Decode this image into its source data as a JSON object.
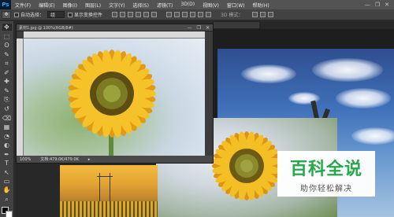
{
  "app": {
    "logo": "Ps"
  },
  "menu": [
    "文件(F)",
    "编辑(E)",
    "图像(I)",
    "图层(L)",
    "文字(Y)",
    "选择(S)",
    "滤镜(T)",
    "3D(D)",
    "视图(V)",
    "窗口(W)",
    "帮助(H)"
  ],
  "window_controls": [
    "—",
    "❐",
    "✕"
  ],
  "options_bar": {
    "auto_select_label": "自动选择：",
    "auto_select_value": "组",
    "show_transform_label": "显示变换控件",
    "mode_3d_label": "3D 模式："
  },
  "document": {
    "title": "素材1.jpg @ 100%(RGB/8#)",
    "zoom": "100%",
    "doc_info": "文档:479.0K/479.0K",
    "controls": [
      "—",
      "❐",
      "✕"
    ]
  },
  "tools": [
    "move-tool",
    "marquee-tool",
    "lasso-tool",
    "quick-select-tool",
    "crop-tool",
    "eyedropper-tool",
    "healing-tool",
    "brush-tool",
    "clone-stamp-tool",
    "history-brush-tool",
    "eraser-tool",
    "gradient-tool",
    "blur-tool",
    "dodge-tool",
    "pen-tool",
    "type-tool",
    "path-select-tool",
    "shape-tool",
    "hand-tool",
    "zoom-tool"
  ],
  "tool_glyphs": [
    "✥",
    "⬚",
    "ʘ",
    "✎",
    "⌗",
    "✐",
    "✚",
    "✎",
    "⎘",
    "↺",
    "⌫",
    "▦",
    "◔",
    "◐",
    "✒",
    "T",
    "↖",
    "▭",
    "✋",
    "⌕"
  ],
  "watermark": {
    "title": "百科全说",
    "subtitle": "助你轻松解决"
  },
  "colors": {
    "ps_blue": "#31a8ff",
    "watermark_green": "#25a94a",
    "panel_gray": "#424242"
  }
}
